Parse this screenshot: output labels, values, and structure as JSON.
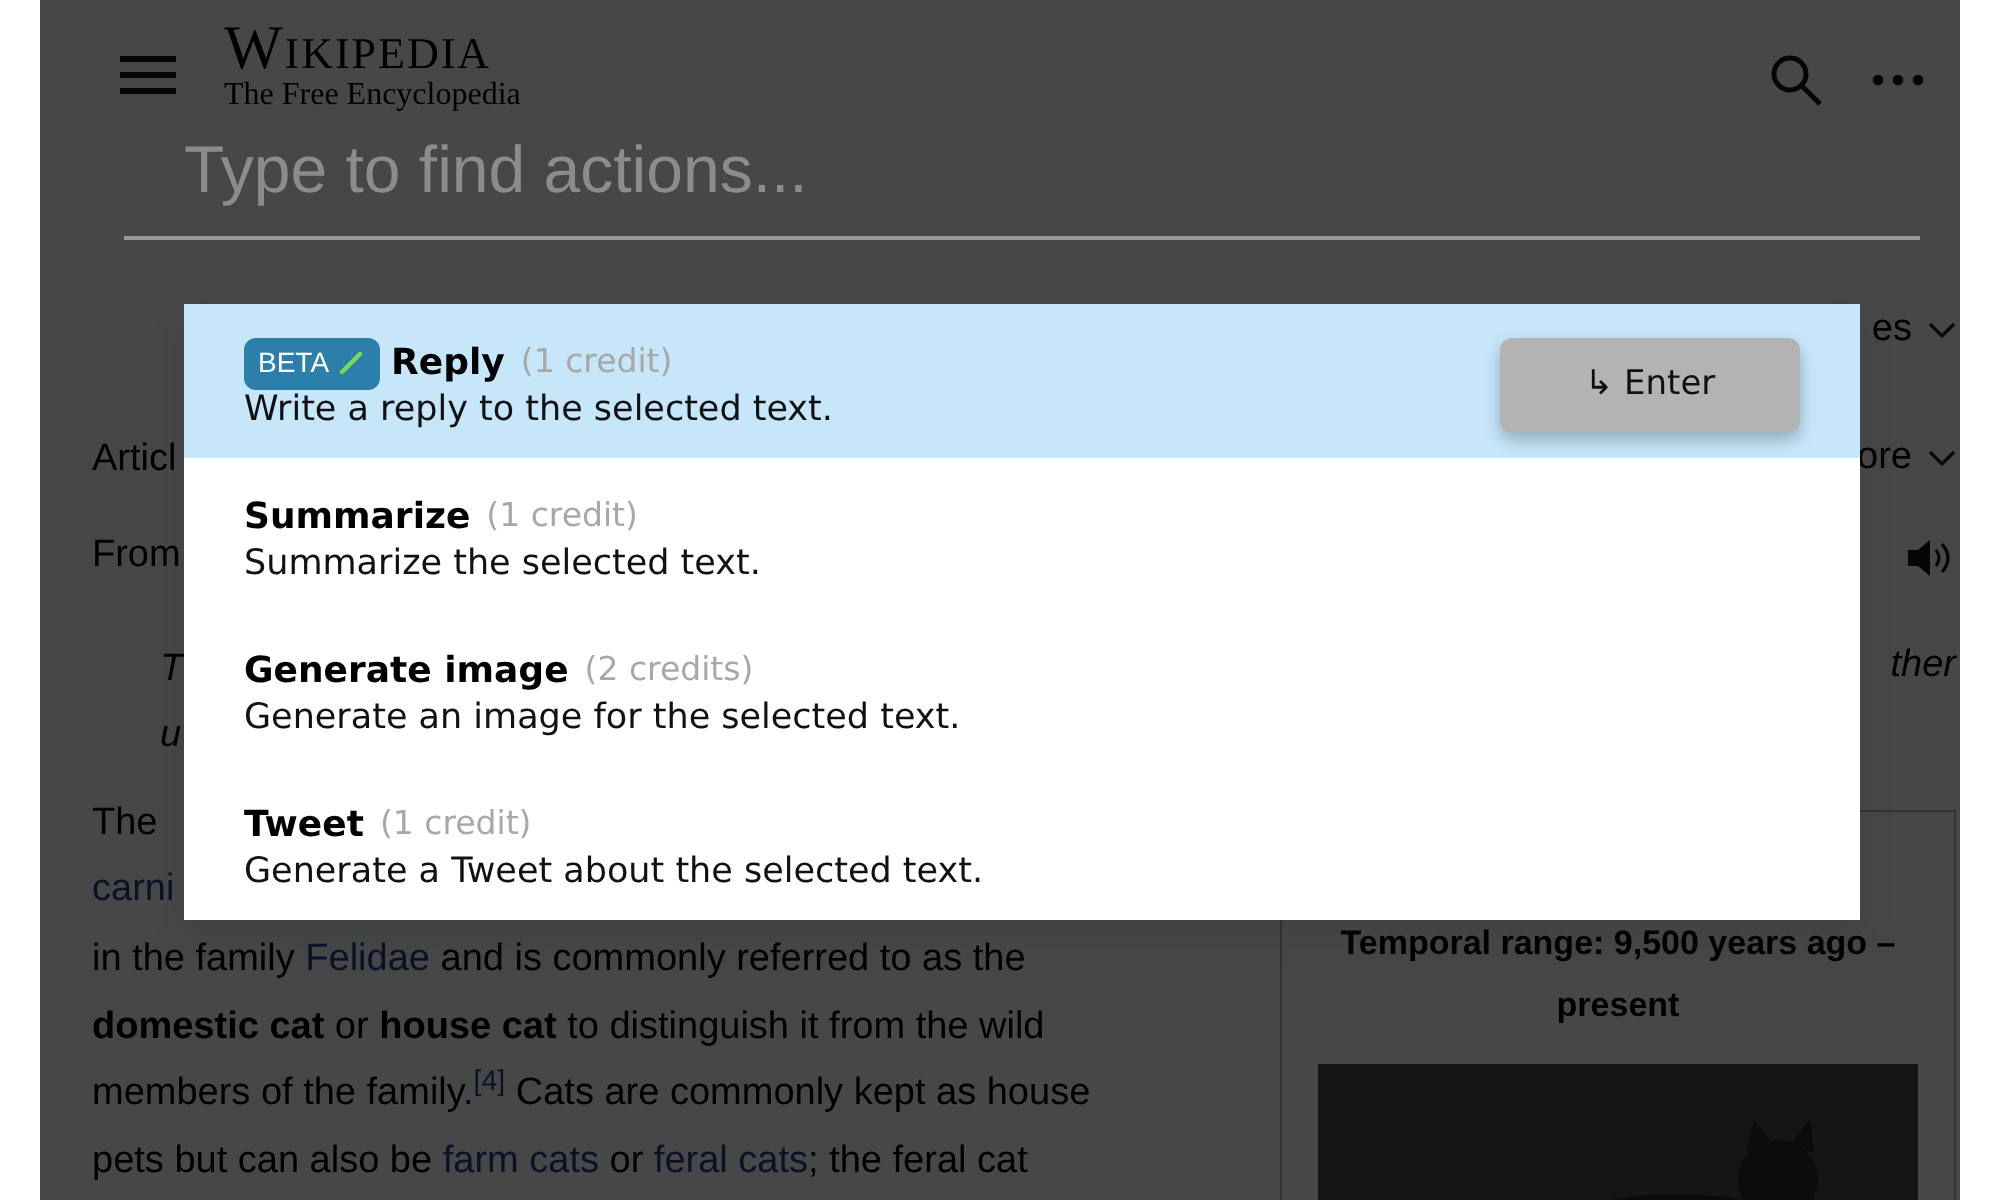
{
  "header": {
    "logo_title": "Wikipedia",
    "logo_subtitle": "The Free Encyclopedia"
  },
  "command_input": {
    "placeholder": "Type to find actions..."
  },
  "actions": [
    {
      "badge": "BETA",
      "title": "Reply",
      "credit": "(1 credit)",
      "description": "Write a reply to the selected text.",
      "shortcut": "↳ Enter",
      "selected": true
    },
    {
      "title": "Summarize",
      "credit": "(1 credit)",
      "description": "Summarize the selected text.",
      "selected": false
    },
    {
      "title": "Generate image",
      "credit": "(2 credits)",
      "description": "Generate an image for the selected text.",
      "selected": false
    },
    {
      "title": "Tweet",
      "credit": "(1 credit)",
      "description": "Generate a Tweet about the selected text.",
      "selected": false
    }
  ],
  "article": {
    "left_fragments": [
      {
        "text": "Articl",
        "kind": "tab"
      },
      {
        "text": "From",
        "kind": "plain"
      },
      {
        "text": "T",
        "kind": "italic"
      },
      {
        "text": "u",
        "kind": "italic"
      },
      {
        "text": "The",
        "kind": "plain"
      },
      {
        "text": "carni",
        "kind": "link"
      }
    ],
    "lines": [
      [
        {
          "text": "in the family ",
          "kind": "plain"
        },
        {
          "text": "Felidae",
          "kind": "link"
        },
        {
          "text": " and is commonly referred to as the",
          "kind": "plain"
        }
      ],
      [
        {
          "text": "domestic cat",
          "kind": "bold"
        },
        {
          "text": " or ",
          "kind": "plain"
        },
        {
          "text": "house cat",
          "kind": "bold"
        },
        {
          "text": " to distinguish it from the wild",
          "kind": "plain"
        }
      ],
      [
        {
          "text": "members of the family.",
          "kind": "plain"
        },
        {
          "text": "[4]",
          "kind": "ref"
        },
        {
          "text": " Cats are commonly kept as house",
          "kind": "plain"
        }
      ],
      [
        {
          "text": "pets but can also be ",
          "kind": "plain"
        },
        {
          "text": "farm cats",
          "kind": "link"
        },
        {
          "text": " or ",
          "kind": "plain"
        },
        {
          "text": "feral cats",
          "kind": "link"
        },
        {
          "text": "; the feral cat",
          "kind": "plain"
        }
      ]
    ],
    "right_fragments": [
      {
        "text": "es",
        "kind": "dropdown"
      },
      {
        "text": "ore",
        "kind": "dropdown"
      },
      {
        "kind": "audio"
      },
      {
        "text": "ther",
        "kind": "italic"
      }
    ],
    "infobox": {
      "caption": "Temporal range: 9,500 years ago – present"
    }
  }
}
